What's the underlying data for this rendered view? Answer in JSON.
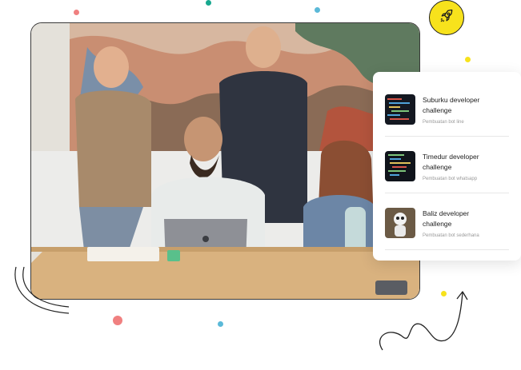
{
  "accent_colors": {
    "yellow": "#f7e21c",
    "coral": "#f08080",
    "teal": "#17a88f",
    "sky": "#5bb9d8"
  },
  "badge": {
    "icon": "rocket-icon"
  },
  "photo": {
    "alt_icon": "team-photo"
  },
  "challenges": [
    {
      "title": "Suburku developer challenge",
      "subtitle": "Pembuatan bot line",
      "thumb": "code-thumbnail"
    },
    {
      "title": "Timedur developer challenge",
      "subtitle": "Pembuatan bot whatsapp",
      "thumb": "code-thumbnail"
    },
    {
      "title": "Baliz developer challenge",
      "subtitle": "Pembuatan bot sederhana",
      "thumb": "robot-thumbnail"
    }
  ]
}
